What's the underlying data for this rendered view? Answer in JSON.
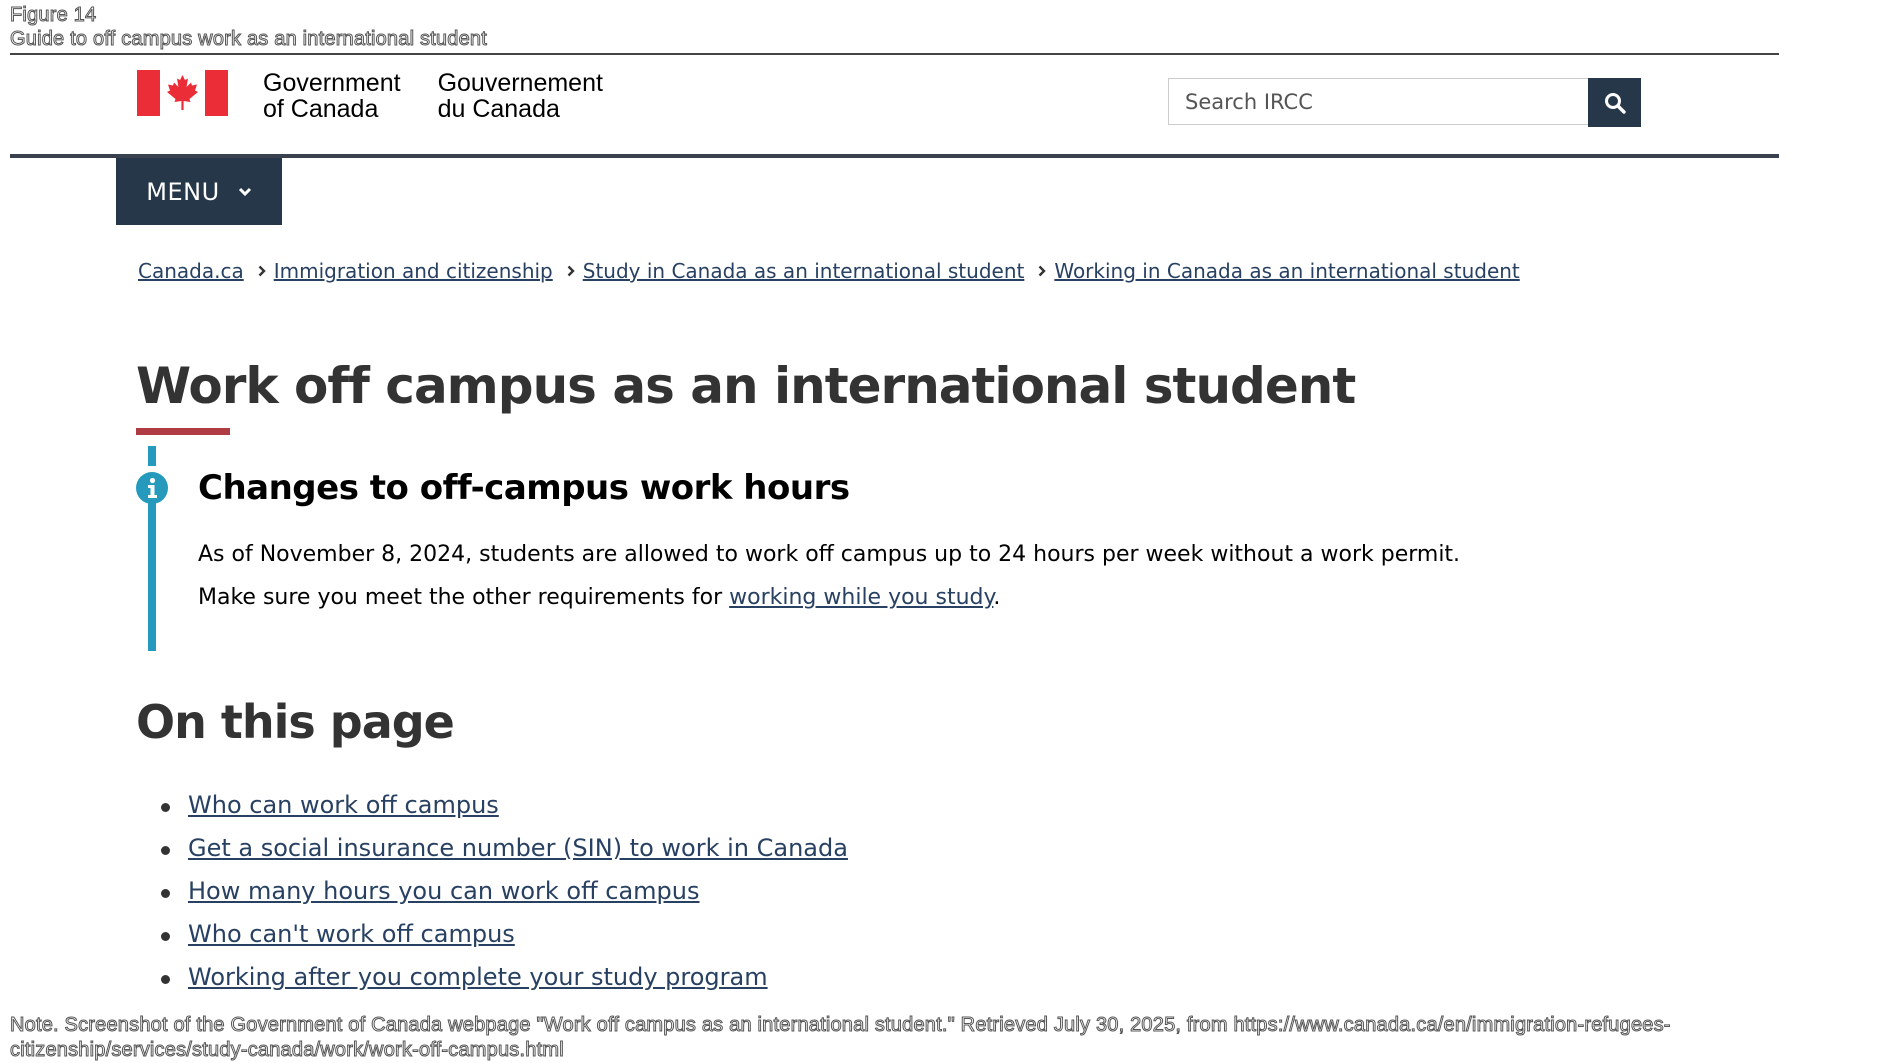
{
  "figure": {
    "label": "Figure 14",
    "title": "Guide to off campus work as an international student",
    "note": "Note. Screenshot of the Government of Canada webpage \"Work off campus as an international student.\" Retrieved July 30, 2025, from https://www.canada.ca/en/immigration-refugees-citizenship/services/study-canada/work/work-off-campus.html"
  },
  "header": {
    "signature_en_line1": "Government",
    "signature_en_line2": "of Canada",
    "signature_fr_line1": "Gouvernement",
    "signature_fr_line2": "du Canada",
    "search_placeholder": "Search IRCC",
    "search_button_icon": "search-icon",
    "menu_label": "MENU",
    "colors": {
      "flag_red": "#eb2d37",
      "nav_dark": "#26374a",
      "link": "#284162",
      "title_underline": "#af3c43",
      "info_accent": "#269abc"
    }
  },
  "breadcrumb": [
    {
      "label": "Canada.ca"
    },
    {
      "label": "Immigration and citizenship"
    },
    {
      "label": "Study in Canada as an international student"
    },
    {
      "label": "Working in Canada as an international student"
    }
  ],
  "main": {
    "title": "Work off campus as an international student",
    "alert": {
      "heading": "Changes to off-campus work hours",
      "line1": "As of November 8, 2024, students are allowed to work off campus up to 24 hours per week without a work permit.",
      "line2_prefix": "Make sure you meet the other requirements for ",
      "line2_link": "working while you study",
      "line2_suffix": "."
    },
    "on_this_page": {
      "heading": "On this page",
      "items": [
        "Who can work off campus",
        "Get a social insurance number (SIN) to work in Canada",
        "How many hours you can work off campus",
        "Who can't work off campus",
        "Working after you complete your study program"
      ]
    }
  }
}
